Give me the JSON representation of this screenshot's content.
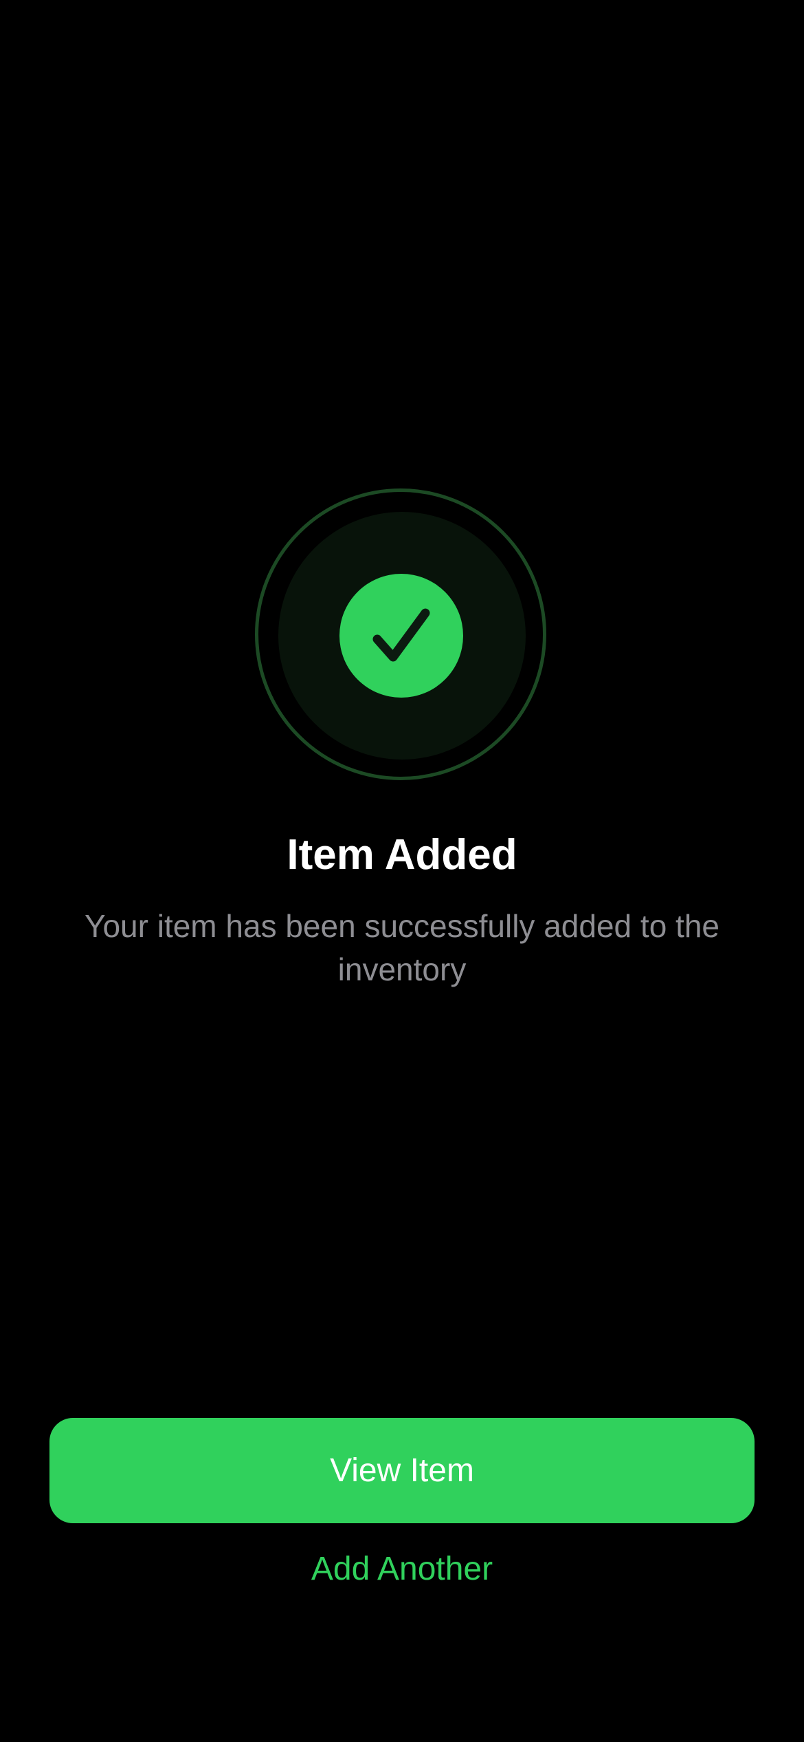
{
  "success": {
    "icon": "checkmark-icon",
    "title": "Item Added",
    "message": "Your item has been successfully added to the inventory"
  },
  "actions": {
    "primary_label": "View Item",
    "secondary_label": "Add Another"
  },
  "colors": {
    "background": "#000000",
    "accent": "#30d15c",
    "ring": "#1c4a24",
    "halo": "#08130a",
    "title": "#ffffff",
    "message": "#8e8e93"
  }
}
